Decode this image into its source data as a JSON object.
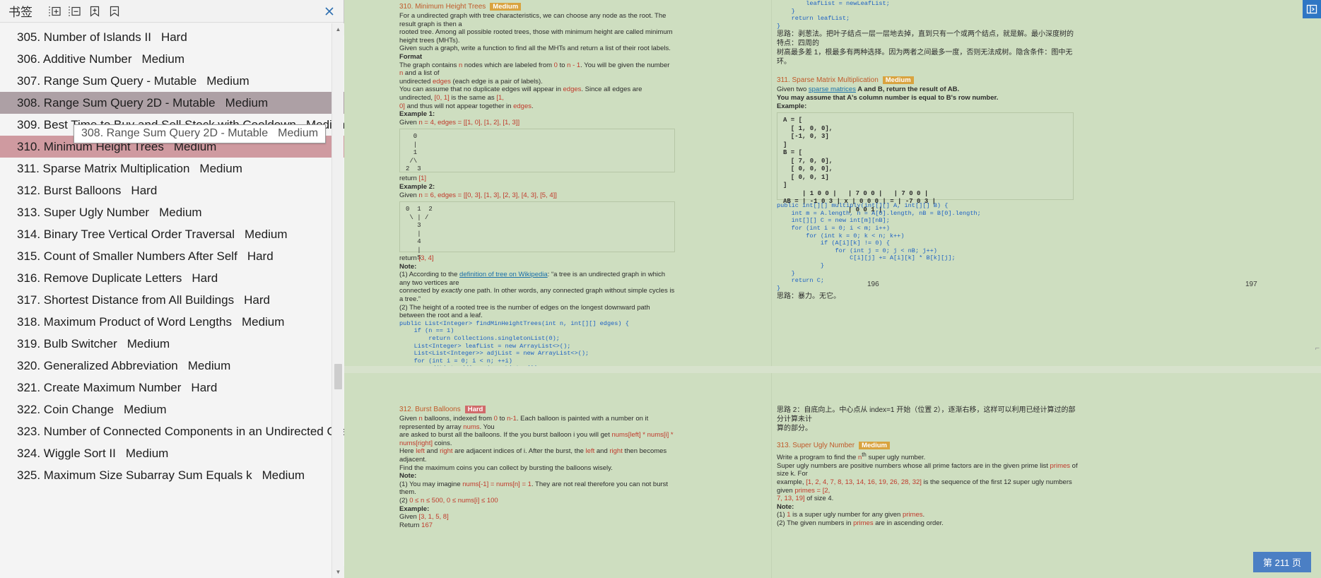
{
  "sidebar": {
    "title": "书签",
    "toolbar": [
      {
        "name": "expand-all-icon",
        "label": "Expand all"
      },
      {
        "name": "collapse-all-icon",
        "label": "Collapse all"
      },
      {
        "name": "add-bookmark-icon",
        "label": "Add bookmark"
      },
      {
        "name": "remove-bookmark-icon",
        "label": "Remove bookmark"
      }
    ],
    "close_label": "✕",
    "bookmarks": [
      {
        "num": "305.",
        "title": "Number of Islands II",
        "diff": "Hard",
        "state": "normal"
      },
      {
        "num": "306.",
        "title": "Additive Number",
        "diff": "Medium",
        "state": "normal"
      },
      {
        "num": "307.",
        "title": "Range Sum Query - Mutable",
        "diff": "Medium",
        "state": "normal"
      },
      {
        "num": "308.",
        "title": "Range Sum Query 2D - Mutable",
        "diff": "Medium",
        "state": "sel-a"
      },
      {
        "num": "309.",
        "title": "Best Time to Buy and Sell Stock with Cooldown",
        "diff": "Medium",
        "state": "normal"
      },
      {
        "num": "310.",
        "title": "Minimum Height Trees",
        "diff": "Medium",
        "state": "sel-b"
      },
      {
        "num": "311.",
        "title": "Sparse Matrix Multiplication",
        "diff": "Medium",
        "state": "normal"
      },
      {
        "num": "312.",
        "title": "Burst Balloons",
        "diff": "Hard",
        "state": "normal"
      },
      {
        "num": "313.",
        "title": "Super Ugly Number",
        "diff": "Medium",
        "state": "normal"
      },
      {
        "num": "314.",
        "title": "Binary Tree Vertical Order Traversal",
        "diff": "Medium",
        "state": "normal"
      },
      {
        "num": "315.",
        "title": "Count of Smaller Numbers After Self",
        "diff": "Hard",
        "state": "normal"
      },
      {
        "num": "316.",
        "title": "Remove Duplicate Letters",
        "diff": "Hard",
        "state": "normal"
      },
      {
        "num": "317.",
        "title": "Shortest Distance from All Buildings",
        "diff": "Hard",
        "state": "normal"
      },
      {
        "num": "318.",
        "title": "Maximum Product of Word Lengths",
        "diff": "Medium",
        "state": "normal"
      },
      {
        "num": "319.",
        "title": "Bulb Switcher",
        "diff": "Medium",
        "state": "normal"
      },
      {
        "num": "320.",
        "title": "Generalized Abbreviation",
        "diff": "Medium",
        "state": "normal"
      },
      {
        "num": "321.",
        "title": "Create Maximum Number",
        "diff": "Hard",
        "state": "normal"
      },
      {
        "num": "322.",
        "title": "Coin Change",
        "diff": "Medium",
        "state": "normal"
      },
      {
        "num": "323.",
        "title": "Number of Connected Components in an Undirected Graph",
        "diff": "M...",
        "state": "normal"
      },
      {
        "num": "324.",
        "title": "Wiggle Sort II",
        "diff": "Medium",
        "state": "normal"
      },
      {
        "num": "325.",
        "title": "Maximum Size Subarray Sum Equals k",
        "diff": "Medium",
        "state": "normal"
      }
    ],
    "tooltip": {
      "title": "308. Range Sum Query 2D - Mutable",
      "diff": "Medium"
    }
  },
  "viewer": {
    "page_pill": "第 211 页",
    "edge_button_icon": "panel-toggle-icon",
    "pages": {
      "left_number": "196",
      "right_number": "197"
    }
  },
  "doc": {
    "p196_left": {
      "heading": "310. Minimum Height Trees",
      "badge": "Medium",
      "para1_l1": "For a undirected graph with tree characteristics, we can choose any node as the root. The result graph is then a",
      "para1_l2": "rooted tree. Among all possible rooted trees, those with minimum height are called minimum height trees (MHTs).",
      "para1_l3": "Given such a graph, write a function to find all the MHTs and return a list of their root labels.",
      "format_label": "Format",
      "format_l1a": "The graph contains ",
      "format_n1": "n",
      "format_l1b": " nodes which are labeled from ",
      "format_0": "0",
      "format_l1c": " to ",
      "format_nm1": "n - 1",
      "format_l1d": ". You will be given the number ",
      "format_n2": "n",
      "format_l1e": " and a list of",
      "format_l2a": "undirected ",
      "format_edges1": "edges",
      "format_l2b": " (each edge is a pair of labels).",
      "assume_l1a": "You can assume that no duplicate edges will appear in ",
      "assume_edges1": "edges",
      "assume_l1b": ". Since all edges are undirected, ",
      "assume_code1": "[0, 1]",
      "assume_l1c": " is the same as ",
      "assume_code2": "[1,",
      "assume_l2a": "0]",
      "assume_l2b": " and thus will not appear together in ",
      "assume_edges2": "edges",
      "assume_l2c": ".",
      "ex1_label": "Example 1:",
      "ex1_given_a": "Given ",
      "ex1_given_n": "n = 4",
      "ex1_given_b": ", edges = ",
      "ex1_given_e": "[[1, 0], [1, 2], [1, 3]]",
      "ex1_art": "  0\n  |\n  1\n /\\\n2  3",
      "ex1_return_a": "return ",
      "ex1_return_b": "[1]",
      "ex2_label": "Example 2:",
      "ex2_given_a": "Given ",
      "ex2_given_n": "n = 6",
      "ex2_given_b": ", edges = ",
      "ex2_given_e": "[[0, 3], [1, 3], [2, 3], [4, 3], [5, 4]]",
      "ex2_art": "0  1  2\n \\ | /\n   3\n   |\n   4\n   |\n   5",
      "ex2_return_a": "return ",
      "ex2_return_b": "[3, 4]",
      "note_label": "Note:",
      "note1_a": "(1) According to the ",
      "note1_link": "definition of tree on Wikipedia",
      "note1_b": ": “a tree is an undirected graph in which any two vertices are",
      "note1_c": "connected by ",
      "note1_em": "exactly",
      "note1_d": " one path. In other words, any connected graph without simple cycles is a tree.”",
      "note2": "(2) The height of a rooted tree is the number of edges on the longest downward path between the root and a leaf.",
      "code": "public List<Integer> findMinHeightTrees(int n, int[][] edges) {\n    if (n == 1)\n        return Collections.singletonList(0);\n    List<Integer> leafList = new ArrayList<>();\n    List<List<Integer>> adjList = new ArrayList<>();\n    for (int i = 0; i < n; ++i)\n        adjList.add(new ArrayList<>());\n    for (int[] edge : edges) {"
    },
    "p197_right_top": {
      "code_cont": "        leafList = newLeafList;\n    }\n    return leafList;\n}",
      "cjk_l1": "思路：剥葱法。把叶子结点一层一层地去掉，直到只有一个或两个结点，就是解。最小深度树的特点：四周的",
      "cjk_l2": "树高最多差 1，根最多有两种选择。因为两者之间最多一度，否则无法成树。隐含条件：图中无环。",
      "heading2": "311. Sparse Matrix Multiplication",
      "badge2": "Medium",
      "s311_l1a": "Given two ",
      "s311_link": "sparse matrices",
      "s311_l1b": " A and B, return the result of AB.",
      "s311_l2": "You may assume that A's column number is equal to B's row number.",
      "s311_ex": "Example:",
      "s311_matrix": "A = [\n  [ 1, 0, 0],\n  [-1, 0, 3]\n]\nB = [\n  [ 7, 0, 0],\n  [ 0, 0, 0],\n  [ 0, 0, 1]\n]\n     | 1 0 0 |   | 7 0 0 |   | 7 0 0 |\nAB = | -1 0 3 | x | 0 0 0 | = | -7 0 3 |\n                 | 0 0 1 |",
      "s311_code": "public int[][] multiply(int[][] A, int[][] B) {\n    int m = A.length, n = A[0].length, nB = B[0].length;\n    int[][] C = new int[m][nB];\n    for (int i = 0; i < m; i++)\n        for (int k = 0; k < n; k++)\n            if (A[i][k] != 0) {\n                for (int j = 0; j < nB; j++)\n                    C[i][j] += A[i][k] * B[k][j];\n            }\n    }\n    return C;\n}",
      "s311_cjk": "思路：暴力。无它。"
    },
    "p197_bottom_left": {
      "heading": "312. Burst Balloons",
      "badge": "Hard",
      "l1a": "Given ",
      "l1n": "n",
      "l1b": " balloons, indexed from ",
      "l1_0": "0",
      "l1c": " to ",
      "l1_nm1": "n-1",
      "l1d": ". Each balloon is painted with a number on it represented by array ",
      "l1nums": "nums",
      "l1e": ". You",
      "l2": "are asked to burst all the balloons. If the you burst balloon i you will get ",
      "l2code": "nums[left] * nums[i] * nums[right]",
      "l2b": " coins.",
      "l3a": "Here ",
      "l3left": "left",
      "l3b": " and ",
      "l3right": "right",
      "l3c": " are adjacent indices of i. After the burst, the ",
      "l3left2": "left",
      "l3d": " and ",
      "l3right2": "right",
      "l3e": " then becomes adjacent.",
      "l4": "Find the maximum coins you can collect by bursting the balloons wisely.",
      "note_label": "Note:",
      "n1a": "(1) You may imagine ",
      "n1code": "nums[-1] = nums[n] = 1",
      "n1b": ". They are not real therefore you can not burst them.",
      "n2a": "(2) ",
      "n2code": "0 ≤ n ≤ 500, 0 ≤ nums[i] ≤ 100",
      "ex_label": "Example:",
      "ex_given_a": "Given ",
      "ex_given_b": "[3, 1, 5, 8]",
      "ret_a": "Return ",
      "ret_b": "167"
    },
    "p197_bottom_right": {
      "cjk_top_l1": "思路 2：自底向上。中心点从 index=1 开始（位置 2），逐渐右移，这样可以利用已经计算过的部分计算未计",
      "cjk_top_l2": "算的部分。",
      "heading": "313. Super Ugly Number",
      "badge": "Medium",
      "l1a": "Write a program to find the ",
      "l1sup": "n",
      "l1th": "th",
      "l1b": " super ugly number.",
      "l2a": "Super ugly numbers are positive numbers whose all prime factors are in the given prime list ",
      "l2primes": "primes",
      "l2b": " of size k. For",
      "l3a": "example, ",
      "l3code": "[1, 2, 4, 7, 8, 13, 14, 16, 19, 26, 28, 32]",
      "l3b": " is the sequence of the first 12 super ugly numbers given ",
      "l3primes": "primes = [2,",
      "l4a": "7, 13, 19]",
      "l4b": " of size 4.",
      "note_label": "Note:",
      "n1a": "(1) ",
      "n1b": "1",
      "n1c": " is a super ugly number for any given ",
      "n1primes": "primes",
      "n1d": ".",
      "n2a": "(2) The given numbers in ",
      "n2primes": "primes",
      "n2b": " are in ascending order."
    }
  }
}
